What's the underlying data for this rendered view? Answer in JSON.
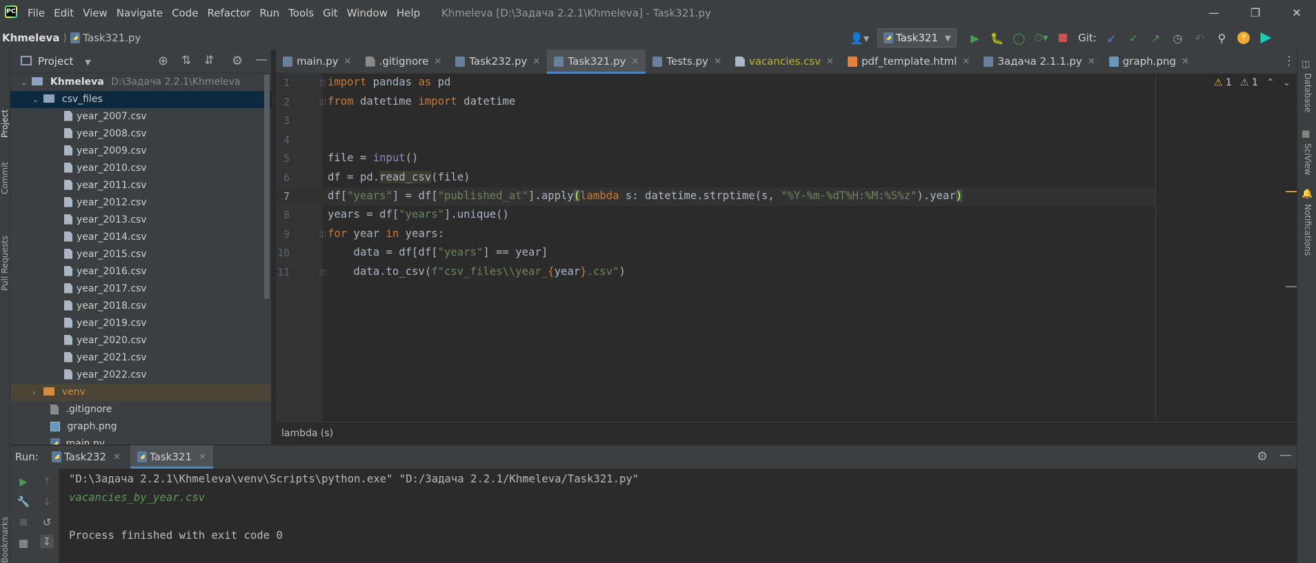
{
  "menu": {
    "items": [
      "File",
      "Edit",
      "View",
      "Navigate",
      "Code",
      "Refactor",
      "Run",
      "Tools",
      "Git",
      "Window",
      "Help"
    ],
    "window_title": "Khmeleva [D:\\Задача 2.2.1\\Khmeleva] - Task321.py"
  },
  "navbar": {
    "project": "Khmeleva",
    "file": "Task321.py",
    "run_config": "Task321",
    "git_label": "Git:"
  },
  "project_panel": {
    "title": "Project",
    "root": "Khmeleva",
    "root_path": "D:\\Задача 2.2.1\\Khmeleva",
    "folder": "csv_files",
    "csv_files": [
      "year_2007.csv",
      "year_2008.csv",
      "year_2009.csv",
      "year_2010.csv",
      "year_2011.csv",
      "year_2012.csv",
      "year_2013.csv",
      "year_2014.csv",
      "year_2015.csv",
      "year_2016.csv",
      "year_2017.csv",
      "year_2018.csv",
      "year_2019.csv",
      "year_2020.csv",
      "year_2021.csv",
      "year_2022.csv"
    ],
    "venv": "venv",
    "other_files": [
      ".gitignore",
      "graph.png",
      "main.py"
    ]
  },
  "left_strip": {
    "project": "Project",
    "commit": "Commit",
    "pull_requests": "Pull Requests",
    "bookmarks": "Bookmarks"
  },
  "right_strip": {
    "database": "Database",
    "sciview": "SciView",
    "notifications": "Notifications"
  },
  "tabs": [
    {
      "label": "main.py",
      "kind": "py"
    },
    {
      "label": ".gitignore",
      "kind": "git"
    },
    {
      "label": "Task232.py",
      "kind": "py"
    },
    {
      "label": "Task321.py",
      "kind": "py",
      "active": true
    },
    {
      "label": "Tests.py",
      "kind": "py"
    },
    {
      "label": "vacancies.csv",
      "kind": "csv"
    },
    {
      "label": "pdf_template.html",
      "kind": "html"
    },
    {
      "label": "Задача 2.1.1.py",
      "kind": "py"
    },
    {
      "label": "graph.png",
      "kind": "png"
    }
  ],
  "editor": {
    "line_numbers": [
      "1",
      "2",
      "3",
      "4",
      "5",
      "6",
      "7",
      "8",
      "9",
      "10",
      "11"
    ],
    "active_line": "7",
    "warnings": "1",
    "weak_warnings": "1",
    "code": {
      "l1_import": "import",
      "l1_mod": " pandas ",
      "l1_as": "as",
      "l1_alias": " pd",
      "l2_from": "from",
      "l2_mod": " datetime ",
      "l2_import": "import",
      "l2_name": " datetime",
      "l5_a": "file = ",
      "l5_input": "input",
      "l5_b": "()",
      "l6_a": "df = pd.",
      "l6_fn": "read_csv",
      "l6_b": "(file)",
      "l7_a": "df[",
      "l7_s1": "\"years\"",
      "l7_b": "] = df[",
      "l7_s2": "\"published_at\"",
      "l7_c": "].apply",
      "l7_paren": "(",
      "l7_lambda": "lambda",
      "l7_d": " s: datetime.strptime(s, ",
      "l7_s3": "\"%Y-%m-%dT%H:%M:%S%z\"",
      "l7_e": ").year",
      "l7_close": ")",
      "l8_a": "years = df[",
      "l8_s": "\"years\"",
      "l8_b": "].unique()",
      "l9_for": "for",
      "l9_a": " year ",
      "l9_in": "in",
      "l9_b": " years:",
      "l10_a": "    data = df[df[",
      "l10_s": "\"years\"",
      "l10_b": "] == year]",
      "l11_a": "    data.to_csv(",
      "l11_s1": "f\"csv_files\\\\year_",
      "l11_b1": "{",
      "l11_var": "year",
      "l11_b2": "}",
      "l11_s2": ".csv\"",
      "l11_c": ")"
    }
  },
  "editor_breadcrumb": "lambda (s)",
  "run_panel": {
    "label": "Run:",
    "tabs": [
      "Task232",
      "Task321"
    ],
    "active_tab": "Task321",
    "console": [
      "\"D:\\Задача 2.2.1\\Khmeleva\\venv\\Scripts\\python.exe\" \"D:/Задача 2.2.1/Khmeleva/Task321.py\"",
      "vacancies_by_year.csv",
      "",
      "Process finished with exit code 0"
    ]
  },
  "colors": {
    "background": "#2b2b2b",
    "panel": "#3c3f41",
    "keyword": "#cc7832",
    "string": "#6a8759",
    "builtin": "#8888c6",
    "accent": "#4a88c7",
    "run_green": "#499c54",
    "stop_red": "#c75450"
  }
}
